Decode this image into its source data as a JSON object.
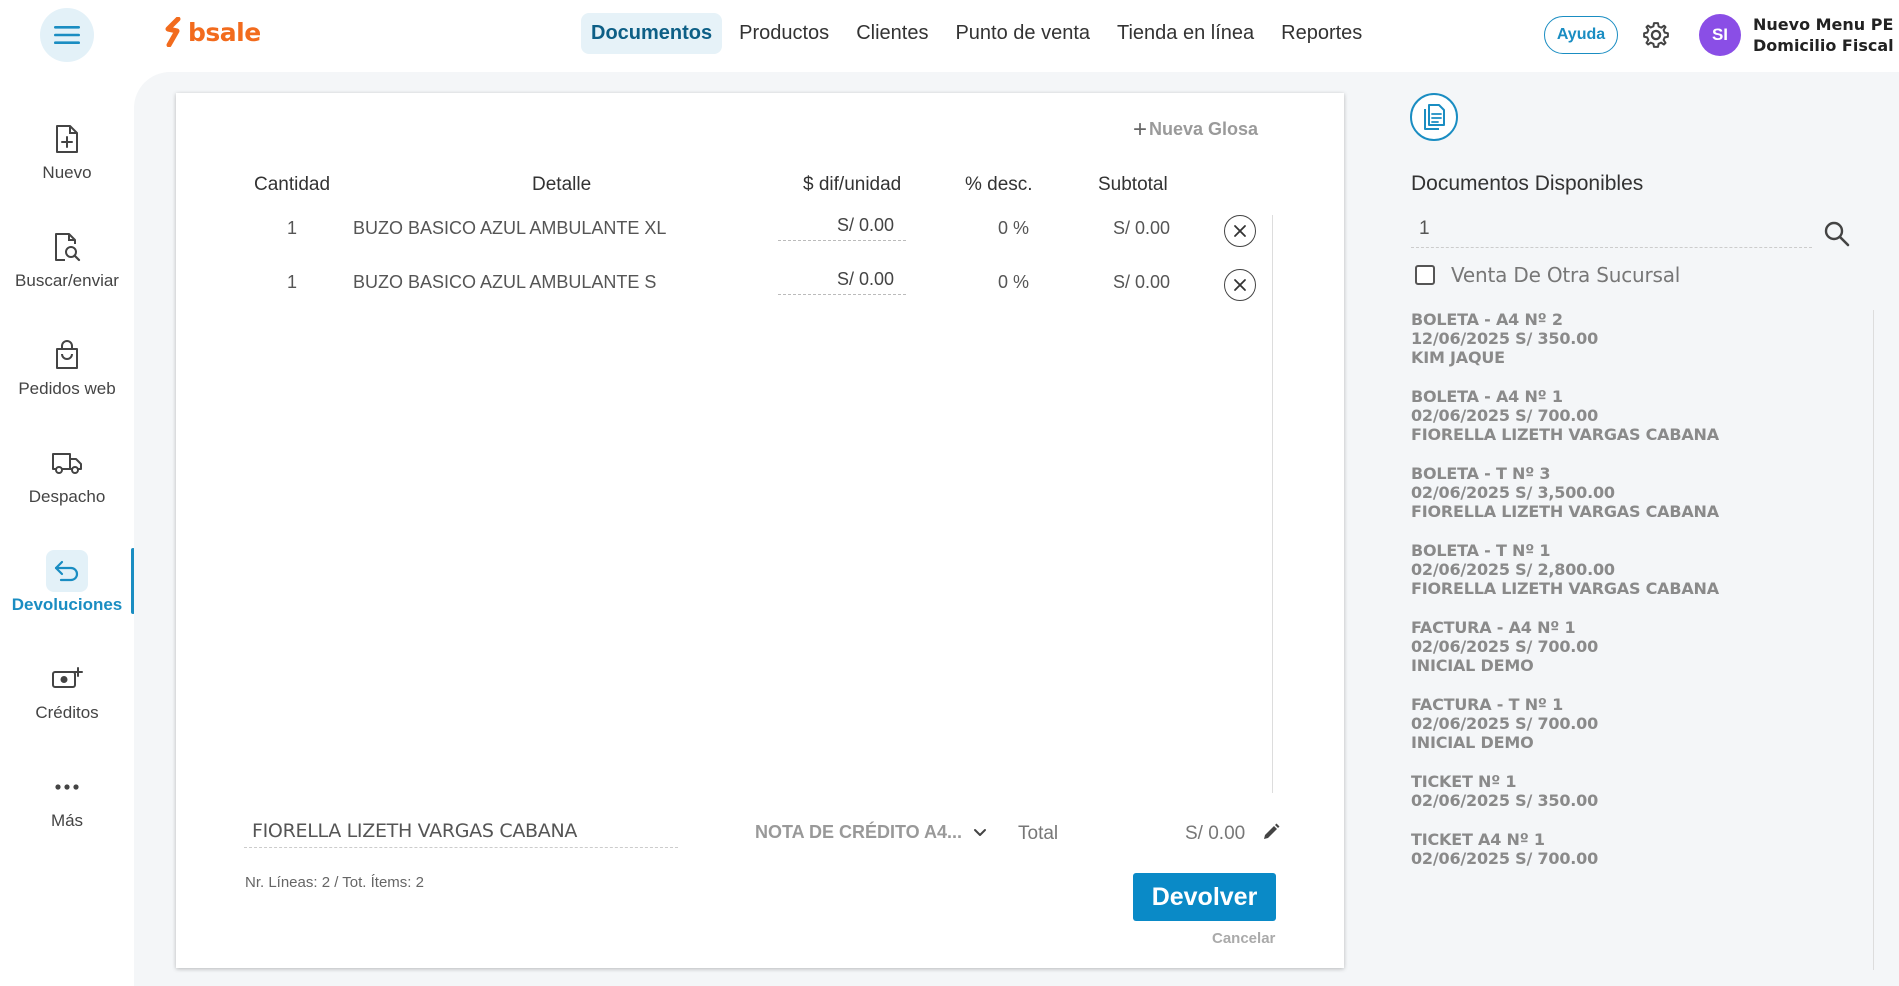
{
  "topbar": {
    "logo_text": "bsale",
    "nav": [
      "Documentos",
      "Productos",
      "Clientes",
      "Punto de venta",
      "Tienda en línea",
      "Reportes"
    ],
    "active_nav": "Documentos",
    "help_label": "Ayuda",
    "avatar_initials": "SI",
    "user_line1": "Nuevo Menu PE",
    "user_line2": "Domicilio Fiscal"
  },
  "sidebar": {
    "items": [
      {
        "label": "Nuevo",
        "icon": "new-document-icon"
      },
      {
        "label": "Buscar/enviar",
        "icon": "search-document-icon"
      },
      {
        "label": "Pedidos web",
        "icon": "shopping-bag-icon"
      },
      {
        "label": "Despacho",
        "icon": "truck-icon"
      },
      {
        "label": "Devoluciones",
        "icon": "return-arrow-icon"
      },
      {
        "label": "Créditos",
        "icon": "money-plus-icon"
      },
      {
        "label": "Más",
        "icon": "more-dots-icon"
      }
    ],
    "active": "Devoluciones"
  },
  "editor": {
    "new_glosa_label": "Nueva Glosa",
    "columns": [
      "Cantidad",
      "Detalle",
      "$ dif/unidad",
      "% desc.",
      "Subtotal"
    ],
    "rows": [
      {
        "qty": "1",
        "detail": "BUZO BASICO AZUL AMBULANTE XL",
        "price": "S/ 0.00",
        "discount": "0 %",
        "subtotal": "S/ 0.00"
      },
      {
        "qty": "1",
        "detail": "BUZO BASICO AZUL AMBULANTE S",
        "price": "S/ 0.00",
        "discount": "0 %",
        "subtotal": "S/ 0.00"
      }
    ],
    "client": "FIORELLA LIZETH VARGAS CABANA",
    "document_type": "NOTA DE CRÉDITO A4...",
    "total_label": "Total",
    "total_value": "S/ 0.00",
    "lines_info": "Nr. Líneas: 2 / Tot. Ítems: 2",
    "submit_label": "Devolver",
    "cancel_label": "Cancelar"
  },
  "available_docs": {
    "title": "Documentos Disponibles",
    "search_value": "1",
    "other_branch_label": "Venta De Otra Sucursal",
    "other_branch_checked": false,
    "items": [
      {
        "line1": "BOLETA - A4 Nº 2",
        "line2": "12/06/2025 S/ 350.00",
        "line3": "KIM JAQUE"
      },
      {
        "line1": "BOLETA - A4 Nº 1",
        "line2": "02/06/2025 S/ 700.00",
        "line3": "FIORELLA LIZETH VARGAS CABANA"
      },
      {
        "line1": "BOLETA - T Nº 3",
        "line2": "02/06/2025 S/ 3,500.00",
        "line3": "FIORELLA LIZETH VARGAS CABANA"
      },
      {
        "line1": "BOLETA - T Nº 1",
        "line2": "02/06/2025 S/ 2,800.00",
        "line3": "FIORELLA LIZETH VARGAS CABANA"
      },
      {
        "line1": "FACTURA - A4 Nº 1",
        "line2": "02/06/2025 S/ 700.00",
        "line3": "INICIAL DEMO"
      },
      {
        "line1": "FACTURA - T Nº 1",
        "line2": "02/06/2025 S/ 700.00",
        "line3": "INICIAL DEMO"
      },
      {
        "line1": "TICKET Nº 1",
        "line2": "02/06/2025 S/ 350.00",
        "line3": ""
      },
      {
        "line1": "TICKET A4 Nº 1",
        "line2": "02/06/2025 S/ 700.00",
        "line3": ""
      }
    ]
  },
  "colors": {
    "accent": "#1a8dc2",
    "brand": "#f26b1d",
    "primary_button": "#0a8ac7",
    "avatar": "#8a4ee6"
  }
}
